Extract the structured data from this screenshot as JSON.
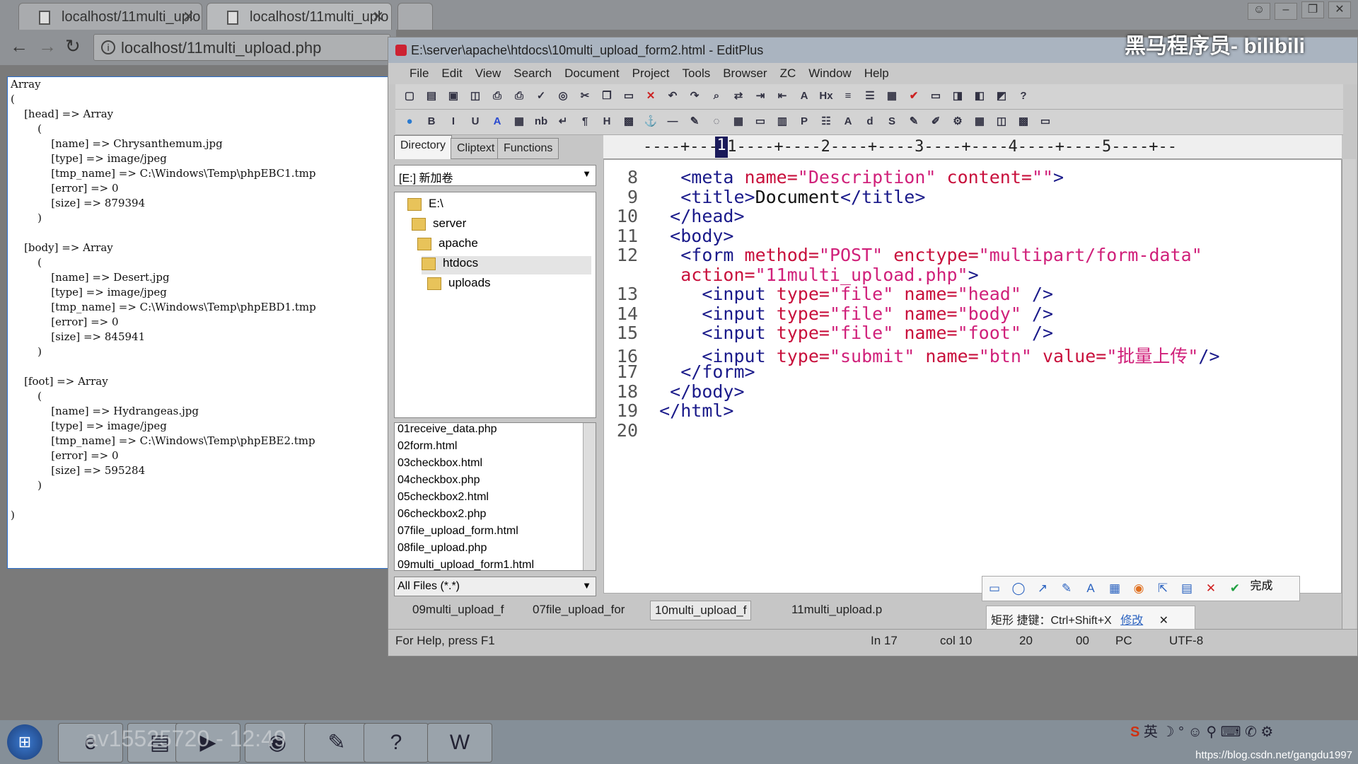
{
  "browser": {
    "tabs": [
      {
        "label": "localhost/11multi_uplo"
      },
      {
        "label": "localhost/11multi_uplo"
      }
    ],
    "address": "localhost/11multi_upload.php"
  },
  "php_output": "Array\n(\n    [head] => Array\n        (\n            [name] => Chrysanthemum.jpg\n            [type] => image/jpeg\n            [tmp_name] => C:\\Windows\\Temp\\phpEBC1.tmp\n            [error] => 0\n            [size] => 879394\n        )\n\n    [body] => Array\n        (\n            [name] => Desert.jpg\n            [type] => image/jpeg\n            [tmp_name] => C:\\Windows\\Temp\\phpEBD1.tmp\n            [error] => 0\n            [size] => 845941\n        )\n\n    [foot] => Array\n        (\n            [name] => Hydrangeas.jpg\n            [type] => image/jpeg\n            [tmp_name] => C:\\Windows\\Temp\\phpEBE2.tmp\n            [error] => 0\n            [size] => 595284\n        )\n\n)",
  "editplus": {
    "title": "E:\\server\\apache\\htdocs\\10multi_upload_form2.html - EditPlus",
    "menu": [
      "File",
      "Edit",
      "View",
      "Search",
      "Document",
      "Project",
      "Tools",
      "Browser",
      "ZC",
      "Window",
      "Help"
    ],
    "panel_tabs": [
      "Directory",
      "Cliptext",
      "Functions"
    ],
    "drive": "[E:] 新加卷",
    "tree": [
      "E:\\",
      "server",
      "apache",
      "htdocs",
      "uploads"
    ],
    "files": [
      "01receive_data.php",
      "02form.html",
      "03checkbox.html",
      "04checkbox.php",
      "05checkbox2.html",
      "06checkbox2.php",
      "07file_upload_form.html",
      "08file_upload.php",
      "09multi_upload_form1.html"
    ],
    "filter": "All Files (*.*)",
    "ruler": "----+----1----+----2----+----3----+----4----+----5----+--",
    "ruler_cursor": "1",
    "doc_tabs": [
      "09multi_upload_f",
      "07file_upload_for",
      "10multi_upload_f",
      "11multi_upload.p"
    ],
    "status": {
      "help": "For Help, press F1",
      "line": "In 17",
      "col": "col 10",
      "n1": "20",
      "n2": "00",
      "mode": "PC",
      "enc": "UTF-8"
    }
  },
  "code_lines": [
    {
      "n": "8",
      "parts": [
        [
          "  ",
          "p"
        ],
        [
          "<meta ",
          "t"
        ],
        [
          "name=",
          "a"
        ],
        [
          "\"Description\"",
          "v"
        ],
        [
          " content=",
          "a"
        ],
        [
          "\"\"",
          "v"
        ],
        [
          ">",
          "t"
        ]
      ]
    },
    {
      "n": "9",
      "parts": [
        [
          "  ",
          "p"
        ],
        [
          "<title>",
          "t"
        ],
        [
          "Document",
          "p"
        ],
        [
          "</title>",
          "t"
        ]
      ]
    },
    {
      "n": "10",
      "parts": [
        [
          " ",
          "p"
        ],
        [
          "</head>",
          "t"
        ]
      ]
    },
    {
      "n": "11",
      "parts": [
        [
          " ",
          "p"
        ],
        [
          "<body>",
          "t"
        ]
      ]
    },
    {
      "n": "12",
      "parts": [
        [
          "  ",
          "p"
        ],
        [
          "<form ",
          "t"
        ],
        [
          "method=",
          "a"
        ],
        [
          "\"POST\"",
          "v"
        ],
        [
          " enctype=",
          "a"
        ],
        [
          "\"multipart/form-data\"",
          "v"
        ]
      ]
    },
    {
      "n": "",
      "parts": [
        [
          "  ",
          "p"
        ],
        [
          "action=",
          "a"
        ],
        [
          "\"11multi_upload.php\"",
          "v"
        ],
        [
          ">",
          "t"
        ]
      ]
    },
    {
      "n": "13",
      "parts": [
        [
          "    ",
          "p"
        ],
        [
          "<input ",
          "t"
        ],
        [
          "type=",
          "a"
        ],
        [
          "\"file\"",
          "v"
        ],
        [
          " name=",
          "a"
        ],
        [
          "\"head\"",
          "v"
        ],
        [
          " />",
          "t"
        ]
      ]
    },
    {
      "n": "14",
      "parts": [
        [
          "    ",
          "p"
        ],
        [
          "<input ",
          "t"
        ],
        [
          "type=",
          "a"
        ],
        [
          "\"file\"",
          "v"
        ],
        [
          " name=",
          "a"
        ],
        [
          "\"body\"",
          "v"
        ],
        [
          " />",
          "t"
        ]
      ]
    },
    {
      "n": "15",
      "parts": [
        [
          "    ",
          "p"
        ],
        [
          "<input ",
          "t"
        ],
        [
          "type=",
          "a"
        ],
        [
          "\"file\"",
          "v"
        ],
        [
          " name=",
          "a"
        ],
        [
          "\"foot\"",
          "v"
        ],
        [
          " />",
          "t"
        ]
      ]
    },
    {
      "n": "16",
      "parts": [
        [
          "    ",
          "p"
        ],
        [
          "<input ",
          "t"
        ],
        [
          "type=",
          "a"
        ],
        [
          "\"submit\"",
          "v"
        ],
        [
          " name=",
          "a"
        ],
        [
          "\"btn\"",
          "v"
        ],
        [
          " value=",
          "a"
        ],
        [
          "\"批量上传\"",
          "v"
        ],
        [
          "/>",
          "t"
        ]
      ]
    },
    {
      "n": "17",
      "parts": [
        [
          "  ",
          "p"
        ],
        [
          "</form>",
          "t"
        ]
      ]
    },
    {
      "n": "18",
      "parts": [
        [
          " ",
          "p"
        ],
        [
          "</body>",
          "t"
        ]
      ]
    },
    {
      "n": "19",
      "parts": [
        [
          "",
          "p"
        ],
        [
          "</html>",
          "t"
        ]
      ]
    },
    {
      "n": "20",
      "parts": []
    }
  ],
  "snip": {
    "done": "完成",
    "tip_label": "矩形",
    "tip_text": "捷键：Ctrl+Shift+X",
    "tip_link": "修改"
  },
  "overlay": {
    "channel": "黑马程序员-",
    "brand": "bilibili",
    "video": "av15525720 - 12:49",
    "url": "https://blog.csdn.net/gangdu1997"
  },
  "colors": {
    "tag": "#1a1a8a",
    "attr": "#c8103c",
    "string": "#d0207a"
  }
}
